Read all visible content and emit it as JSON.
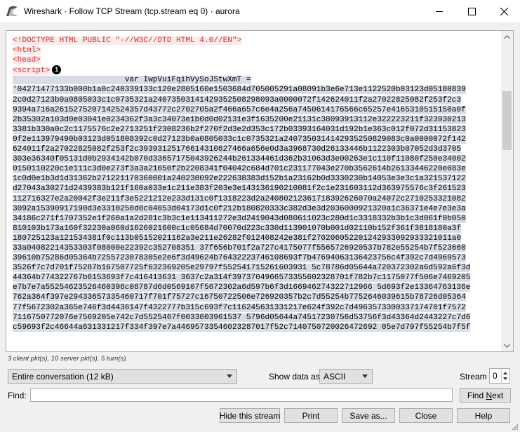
{
  "window": {
    "title": "Wireshark · Follow TCP Stream (tcp.stream eq 0) · aurora"
  },
  "stream": {
    "lines": [
      {
        "text": "<!DOCTYPE HTML PUBLIC \"-//W3C//DTD HTML 4.0//EN\">",
        "style": "hl"
      },
      {
        "text": "<html>",
        "style": "hl"
      },
      {
        "text": "<head>",
        "style": "hl"
      },
      {
        "text": "<script>",
        "style": "hl",
        "marker": "1"
      },
      {
        "text": "                        var IwpVuiFqihVySoJStwXmT =",
        "style": "hl-blue"
      },
      {
        "text": "'04271477133b000b1a0c240339133c120e2805160e1503684d705005291a08091b3e6e713e1122520b03123d05180839",
        "style": "hl-blue"
      },
      {
        "text": "2c0d27123b0a0805033c1c0735321a24073503141429352508298093a0000072f142624011f2a27022825082f253f2c3",
        "style": "hl-blue"
      },
      {
        "text": "9394a716a2615275207142524357d43772c2702705a2f466a657c6e4a256a7450614176566c65257e4165310515150a0f",
        "style": "hl-blue"
      },
      {
        "text": "2b35302a103d0e03041e0234362f3a3c34073e1b0d0d02131e3f1635200e21131c38093913112e322223211f323930213",
        "style": "hl-blue"
      },
      {
        "text": "3381b330a0c2c1175576c2e2713251f2308236b2f270f2d3e2d353c172b03393164031d192b1e363c012f072d31153823",
        "style": "hl-blue"
      },
      {
        "text": "0f2e113979490b03123d051808392c0d27123b0a0805033c1c0735321a2407350314142935250829083c0a0000072f142",
        "style": "hl-blue"
      },
      {
        "text": "624011f2a27022825082f253f2c39393125176614310627466a656e0d3a3968730d26133446b1122303b07052d3d3705",
        "style": "hl-blue"
      },
      {
        "text": "303e36340f05131d0b2934142b070d33657175043926244b261334461d362b31063d3e00263e1c110f11080f250e34002",
        "style": "hl-blue"
      },
      {
        "text": "0150110220c1e111c3d0e273f3a3a21050f2b2208341f04042c684d701c231177043e270b3562614b26133446220e083e",
        "style": "hl-blue"
      },
      {
        "text": "1c0d0e1b3d1d31362b271221170360001a240230092e222638383d152b1a23162b0d3330230b14053e3e3c1a321537122",
        "style": "hl-blue"
      },
      {
        "text": "d27043a30271d2439383b121f160a033e1c211e383f203e3e143136190210081f2c1e231603112d363975576c3f261523",
        "style": "hl-blue"
      },
      {
        "text": "112716327e2a20042f3e211f3e5221212e233d131c0f1318223d2a24080212361718392626070a24072c2710253321082",
        "style": "hl-blue"
      },
      {
        "text": "3092a15390917190d3e3310250d0c04053d04173d1c0f212b180820333c382d3e3d2036000921320a1c36371e4e7e3e3a",
        "style": "hl-blue"
      },
      {
        "text": "34186c271f1707352e1f260a1a2d281c3b3c1e113411272e3d2419043d080611023c280d1c3318332b3b1c3d061f0b050",
        "style": "hl-blue"
      },
      {
        "text": "810103b173a160f32230a060d1626021600c1c05684d70070d223c330d113901070b001d02110b152f361f3818180a3f",
        "style": "hl-blue"
      },
      {
        "text": "180725123a121534381f0c113b05152021162a3e211e26282f012408242e381f270206052201242933092933321011a0",
        "style": "hl-blue"
      },
      {
        "text": "33a04082214353303f08000e22392c352708351 37f656b701f2a727c4175077f5565726920537b782e55254b7f523660",
        "style": "hl-blue"
      },
      {
        "text": "39610b75286d05364b7255723078305e2e6f3d49624b76432223746108693f7b47694063136423756c4f392c7d4969573",
        "style": "hl-blue"
      },
      {
        "text": "3526f7c7d701f75287b167507725f632369205e29797f552541715261603931 5c78786d05644a720372302a6d592a6f3d",
        "style": "hl-blue"
      },
      {
        "text": "44364b774322767b6153693f7c416413631 3637c2a314f3973704966573355602328701f782b7c1175077f506e7469205",
        "style": "hl-blue"
      },
      {
        "text": "e7b7e7a55254623526460396c08787d6d0569107f5672302a6d597b6f3d166946274322712966 5d693f2e13364763136e",
        "style": "hl-blue"
      },
      {
        "text": "762a364f397e29433657335460717f701f75727c16750722506e726920357b2c7d55254b7752646039615b78726d05364",
        "style": "hl-blue"
      },
      {
        "text": "77f5672302a365e746f3d4436147f4322777b315c693f7c116245631331217e624f392c7d4963573300337174701f7572",
        "style": "hl-blue"
      },
      {
        "text": "7116750772076e7569205e742c7d5525467f0033603961537 5796d05644a74517230756d53756f3d43364d2443227c7d6",
        "style": "hl-blue"
      },
      {
        "text": "c59693f2c46644a631331217f334f397e7a44695733546023287017f52c7140750720026472692 05e7d797f55254b7f5f",
        "style": "hl-blue"
      }
    ]
  },
  "status": {
    "packets_text": "3 client pkt(s), 10 server pkt(s), 5 turn(s)."
  },
  "controls": {
    "conversation": "Entire conversation (12 kB)",
    "show_data_label": "Show data as",
    "show_data_value": "ASCII",
    "stream_label": "Stream",
    "stream_value": "0",
    "find_label": "Find:",
    "find_value": "",
    "find_next_pre": "Find ",
    "find_next_u": "N",
    "find_next_post": "ext"
  },
  "buttons": {
    "hide": "Hide this stream",
    "print": "Print",
    "save_as": "Save as...",
    "close": "Close",
    "help": "Help"
  },
  "colors": {
    "client_bg": "#fbeaea",
    "server_bg": "#d8dce6",
    "tag_red": "#d32f2f"
  },
  "icons": {
    "app": "wireshark-fin-icon",
    "minimize": "minimize-icon",
    "maximize": "maximize-icon",
    "close": "close-icon"
  }
}
